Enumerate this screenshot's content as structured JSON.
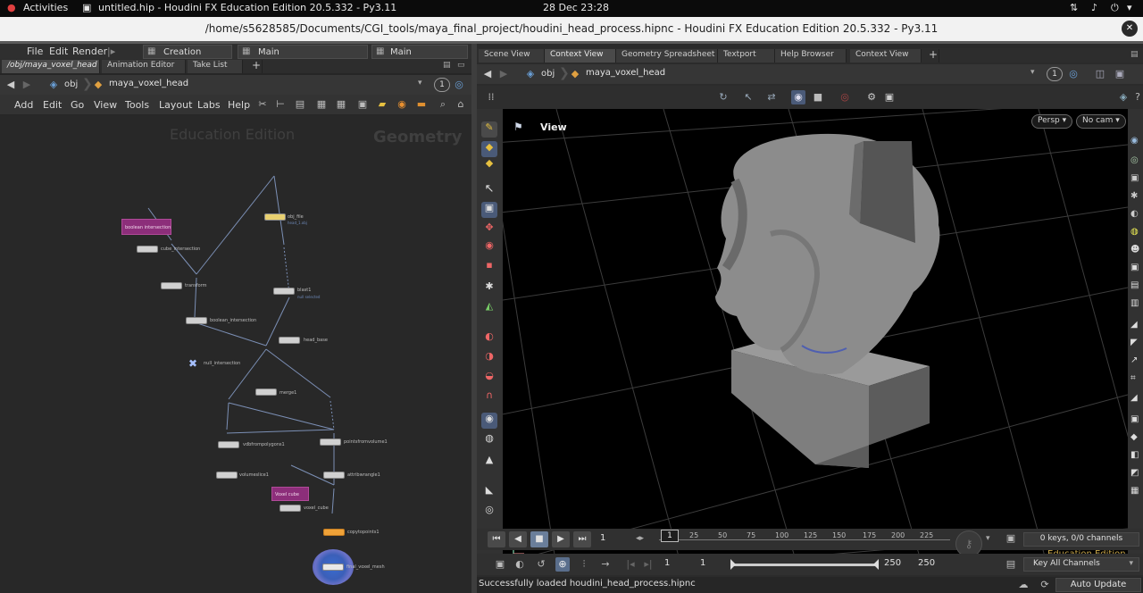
{
  "system_bar": {
    "activities": "Activities",
    "app_title": "untitled.hip - Houdini FX Education Edition 20.5.332 - Py3.11",
    "clock": "28 Dec  23:28",
    "status_icons": [
      "network-icon",
      "volume-icon",
      "power-icon"
    ]
  },
  "window": {
    "title": "/home/s5628585/Documents/CGI_tools/maya_final_project/houdini_head_process.hipnc - Houdini FX Education Edition 20.5.332 - Py3.11",
    "close": "✕"
  },
  "main_menu": {
    "items": [
      "File",
      "Edit",
      "Render"
    ],
    "desktop_left": "Creation",
    "desktop_mid": "Main",
    "desktop_right": "Main"
  },
  "left_tabs": [
    "/obj/maya_voxel_head",
    "Animation Editor",
    "Take List"
  ],
  "left_path": {
    "root": "obj",
    "node": "maya_voxel_head",
    "badge": "1"
  },
  "network_menu": [
    "Add",
    "Edit",
    "Go",
    "View",
    "Tools",
    "Layout",
    "Labs",
    "Help"
  ],
  "network": {
    "watermark_edition": "Education Edition",
    "watermark_context": "Geometry",
    "stickies": [
      {
        "text": "boolean intersection"
      },
      {
        "text": "Voxel cube"
      }
    ],
    "nodes": [
      {
        "name": "obj_file",
        "sub": "head_1.obj"
      },
      {
        "name": "cube_intersection",
        "sub": ""
      },
      {
        "name": "transform",
        "sub": ""
      },
      {
        "name": "blast1",
        "sub": "null selected"
      },
      {
        "name": "boolean_intersection",
        "sub": ""
      },
      {
        "name": "head_base",
        "sub": ""
      },
      {
        "name": "null_intersection",
        "sub": ""
      },
      {
        "name": "merge1",
        "sub": ""
      },
      {
        "name": "vdbfrompolygons1",
        "sub": ""
      },
      {
        "name": "pointsfromvolume1",
        "sub": ""
      },
      {
        "name": "volumeslice1",
        "sub": ""
      },
      {
        "name": "attribwrangle1",
        "sub": ""
      },
      {
        "name": "voxel_cube",
        "sub": ""
      },
      {
        "name": "copytopoints1",
        "sub": ""
      },
      {
        "name": "final_voxel_mesh",
        "sub": ""
      }
    ]
  },
  "right_tabs": [
    "Scene View",
    "Context View",
    "Geometry Spreadsheet",
    "Textport",
    "Help Browser",
    "Context View"
  ],
  "right_path": {
    "root": "obj",
    "node": "maya_voxel_head",
    "badge": "1"
  },
  "viewport": {
    "label": "View",
    "persp": "Persp",
    "camera": "No cam",
    "watermark": "Education Edition"
  },
  "timeline": {
    "current_frame": "1",
    "cursor_frame": "1",
    "ticks": [
      "25",
      "50",
      "75",
      "100",
      "125",
      "150",
      "175",
      "200",
      "225"
    ],
    "keys_info": "0 keys, 0/0 channels",
    "start": "1",
    "start2": "1",
    "end": "250",
    "end2": "250",
    "key_channels": "Key All Channels",
    "realtime_progress": 0.0
  },
  "status": {
    "message": "Successfully loaded houdini_head_process.hipnc",
    "auto_update": "Auto Update"
  },
  "colors": {
    "sticky": "#8c2e7a",
    "output_node": "#f0a238",
    "accent_blue": "#4aa0e0",
    "watermark_yellow": "#c8a64a"
  }
}
